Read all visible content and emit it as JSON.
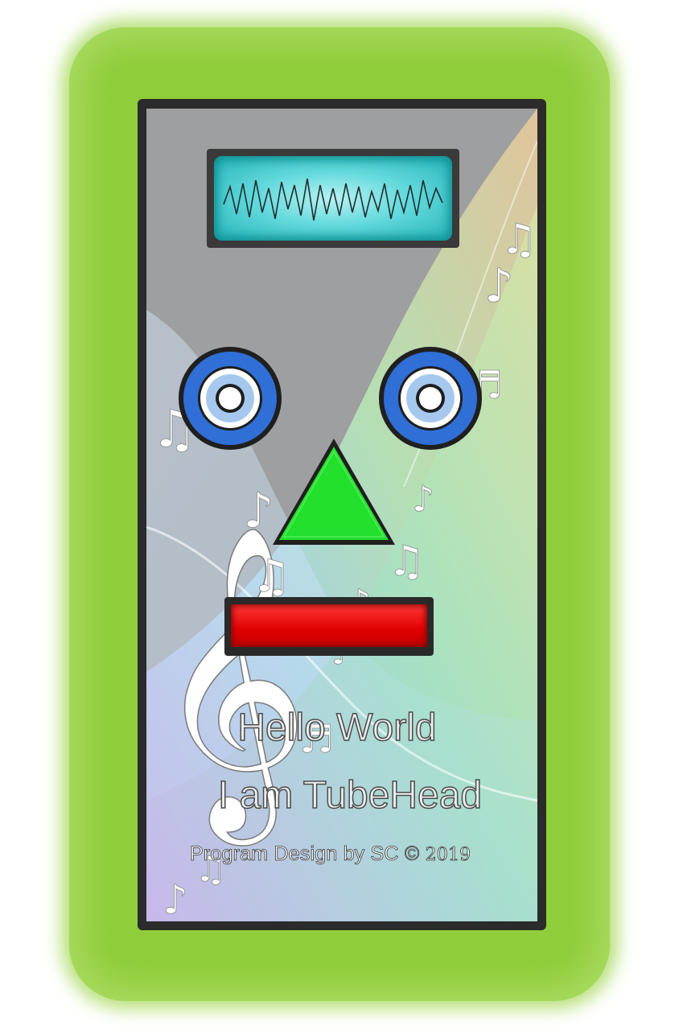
{
  "robot": {
    "greeting_line1": "Hello World",
    "greeting_line2": "I am TubeHead",
    "credit": "Program Design by SC",
    "copyright_symbol": "©",
    "year": "2019"
  },
  "colors": {
    "bezel": "#8fcd3a",
    "face": "#9e9fa0",
    "scope": "#4fd0d3",
    "eye": "#2f6fd6",
    "nose": "#22e02c",
    "mouth": "#e10000"
  },
  "icons": {
    "scope": "oscilloscope-waveform",
    "eyes": "speaker-eye",
    "nose": "triangle",
    "mouth": "red-bar",
    "background": "music-notes-treble-clef"
  }
}
